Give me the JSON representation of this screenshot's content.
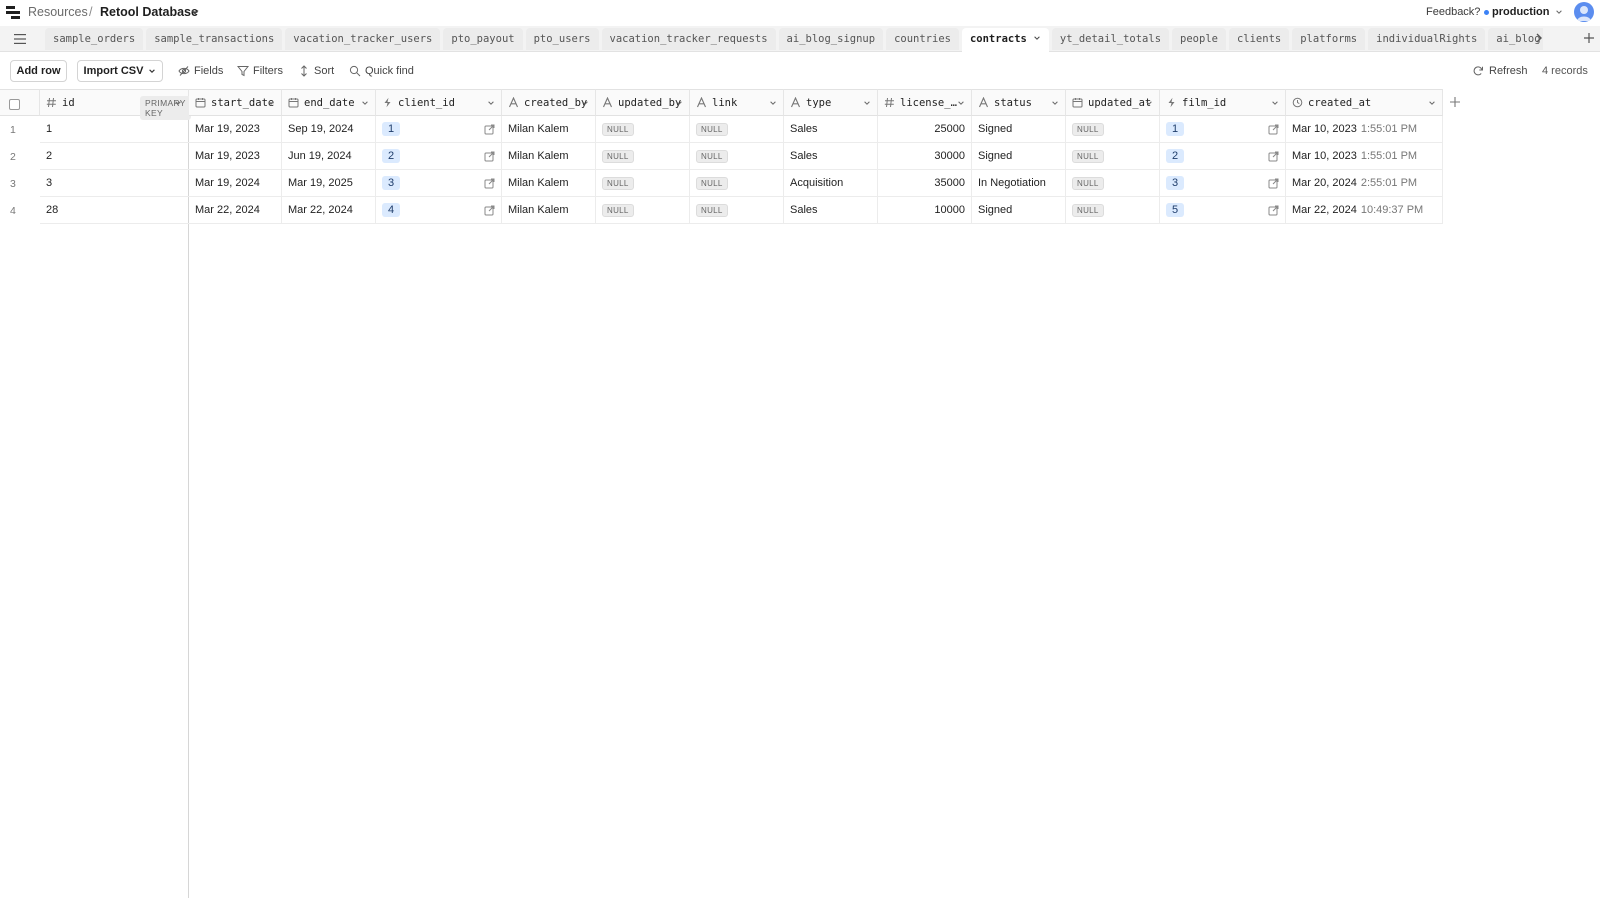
{
  "breadcrumb": {
    "resources": "Resources",
    "separator": "/",
    "database": "Retool Database"
  },
  "header": {
    "feedback": "Feedback?",
    "environment": "production"
  },
  "tabs": [
    {
      "label": "sample_orders",
      "active": false
    },
    {
      "label": "sample_transactions",
      "active": false
    },
    {
      "label": "vacation_tracker_users",
      "active": false
    },
    {
      "label": "pto_payout",
      "active": false
    },
    {
      "label": "pto_users",
      "active": false
    },
    {
      "label": "vacation_tracker_requests",
      "active": false
    },
    {
      "label": "ai_blog_signup",
      "active": false
    },
    {
      "label": "countries",
      "active": false
    },
    {
      "label": "contracts",
      "active": true
    },
    {
      "label": "yt_detail_totals",
      "active": false
    },
    {
      "label": "people",
      "active": false
    },
    {
      "label": "clients",
      "active": false
    },
    {
      "label": "platforms",
      "active": false
    },
    {
      "label": "individualRights",
      "active": false
    },
    {
      "label": "ai_blog",
      "active": false
    }
  ],
  "toolbar": {
    "add_row": "Add row",
    "import_csv": "Import CSV",
    "fields": "Fields",
    "filters": "Filters",
    "sort": "Sort",
    "quick_find": "Quick find",
    "refresh": "Refresh",
    "records": "4 records"
  },
  "table": {
    "primary_key_label": "PRIMARY KEY",
    "null_label": "NULL",
    "columns": [
      {
        "key": "id",
        "label": "id",
        "type": "number"
      },
      {
        "key": "start_date",
        "label": "start_date",
        "type": "date"
      },
      {
        "key": "end_date",
        "label": "end_date",
        "type": "date"
      },
      {
        "key": "client_id",
        "label": "client_id",
        "type": "fk"
      },
      {
        "key": "created_by",
        "label": "created_by",
        "type": "text"
      },
      {
        "key": "updated_by",
        "label": "updated_by",
        "type": "text"
      },
      {
        "key": "link",
        "label": "link",
        "type": "text"
      },
      {
        "key": "type",
        "label": "type",
        "type": "text"
      },
      {
        "key": "license_",
        "label": "license_…",
        "type": "number"
      },
      {
        "key": "status",
        "label": "status",
        "type": "text"
      },
      {
        "key": "updated_at",
        "label": "updated_at",
        "type": "date"
      },
      {
        "key": "film_id",
        "label": "film_id",
        "type": "fk"
      },
      {
        "key": "created_at",
        "label": "created_at",
        "type": "timestamp"
      }
    ],
    "rows": [
      {
        "num": "1",
        "id": "1",
        "start_date": "Mar 19, 2023",
        "end_date": "Sep 19, 2024",
        "client_id": "1",
        "created_by": "Milan Kalem",
        "updated_by": null,
        "link": null,
        "type": "Sales",
        "license_": "25000",
        "status": "Signed",
        "updated_at": null,
        "film_id": "1",
        "created_date": "Mar 10, 2023",
        "created_time": "1:55:01 PM"
      },
      {
        "num": "2",
        "id": "2",
        "start_date": "Mar 19, 2023",
        "end_date": "Jun 19, 2024",
        "client_id": "2",
        "created_by": "Milan Kalem",
        "updated_by": null,
        "link": null,
        "type": "Sales",
        "license_": "30000",
        "status": "Signed",
        "updated_at": null,
        "film_id": "2",
        "created_date": "Mar 10, 2023",
        "created_time": "1:55:01 PM"
      },
      {
        "num": "3",
        "id": "3",
        "start_date": "Mar 19, 2024",
        "end_date": "Mar 19, 2025",
        "client_id": "3",
        "created_by": "Milan Kalem",
        "updated_by": null,
        "link": null,
        "type": "Acquisition",
        "license_": "35000",
        "status": "In Negotiation",
        "updated_at": null,
        "film_id": "3",
        "created_date": "Mar 20, 2024",
        "created_time": "2:55:01 PM"
      },
      {
        "num": "4",
        "id": "28",
        "start_date": "Mar 22, 2024",
        "end_date": "Mar 22, 2024",
        "client_id": "4",
        "created_by": "Milan Kalem",
        "updated_by": null,
        "link": null,
        "type": "Sales",
        "license_": "10000",
        "status": "Signed",
        "updated_at": null,
        "film_id": "5",
        "created_date": "Mar 22, 2024",
        "created_time": "10:49:37 PM"
      }
    ]
  },
  "colors": {
    "accent": "#3b82f6",
    "fk_badge_bg": "#dbeafe",
    "tabs_bg": "#f3f3f3"
  }
}
